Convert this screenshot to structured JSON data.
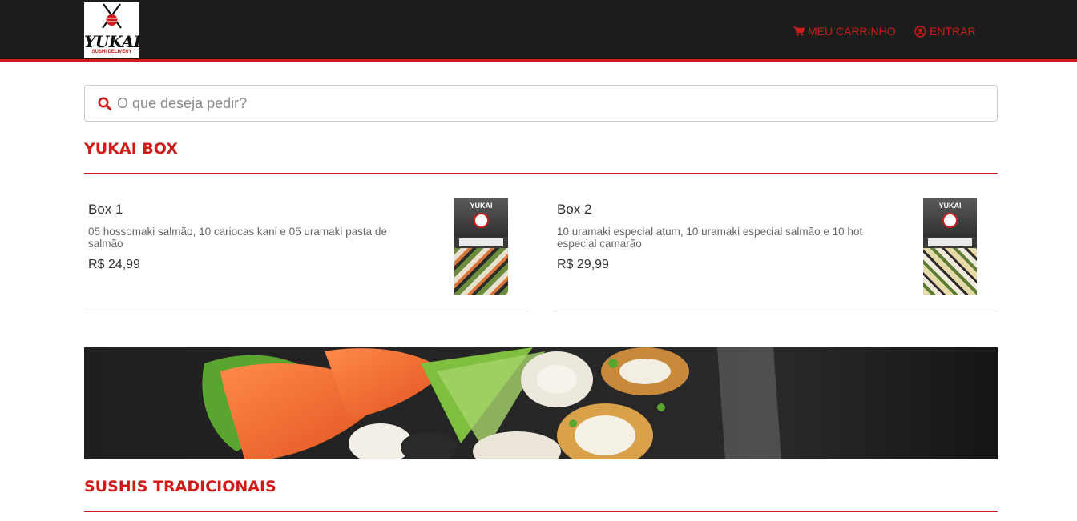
{
  "header": {
    "logo": {
      "word": "YUKAI",
      "subtitle": "SUSHI DELIVERY"
    },
    "cart_label": "MEU CARRINHO",
    "login_label": "ENTRAR"
  },
  "search": {
    "placeholder": "O que deseja pedir?",
    "value": ""
  },
  "sections": [
    {
      "title": "YUKAI BOX",
      "products": [
        {
          "name": "Box 1",
          "description": "05 hossomaki salmão, 10 cariocas kani e 05 uramaki pasta de salmão",
          "price": "R$ 24,99",
          "thumb_word": "YUKAI"
        },
        {
          "name": "Box 2",
          "description": "10 uramaki especial atum, 10 uramaki especial salmão e 10 hot especial camarão",
          "price": "R$ 29,99",
          "thumb_word": "YUKAI"
        }
      ]
    },
    {
      "title": "SUSHIS TRADICIONAIS",
      "products": []
    }
  ],
  "colors": {
    "brand_red": "#d11a1a",
    "header_bg": "#1c1c1c"
  },
  "icons": {
    "cart": "cart-icon",
    "login": "user-circle-icon",
    "search": "search-icon"
  }
}
